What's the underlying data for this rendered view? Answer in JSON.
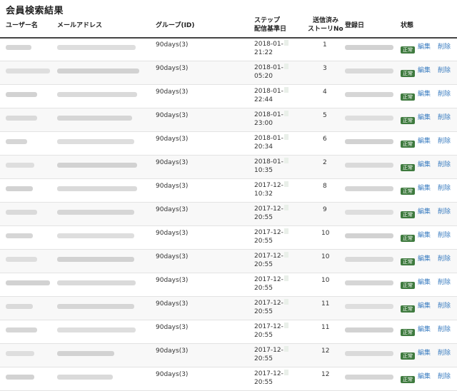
{
  "title": "会員検索結果",
  "columns": {
    "user": "ユーザー名",
    "email": "メールアドレス",
    "group": "グループ(ID)",
    "step_l1": "ステップ",
    "step_l2": "配信基準日",
    "sent_l1": "送信済み",
    "sent_l2": "ストーリNo",
    "registered": "登録日",
    "status": "状態"
  },
  "colors": {
    "badge": "#3e7a3e",
    "link": "#3a7cc0",
    "rule": "#444444"
  },
  "rows": [
    {
      "group": "90days(3)",
      "step_date": "2018-01-",
      "step_time": "21:22",
      "story_no": "1",
      "status": "正常",
      "edit": "編集",
      "delete": "削除"
    },
    {
      "group": "90days(3)",
      "step_date": "2018-01-",
      "step_time": "05:20",
      "story_no": "3",
      "status": "正常",
      "edit": "編集",
      "delete": "削除"
    },
    {
      "group": "90days(3)",
      "step_date": "2018-01-",
      "step_time": "22:44",
      "story_no": "4",
      "status": "正常",
      "edit": "編集",
      "delete": "削除"
    },
    {
      "group": "90days(3)",
      "step_date": "2018-01-",
      "step_time": "23:00",
      "story_no": "5",
      "status": "正常",
      "edit": "編集",
      "delete": "削除"
    },
    {
      "group": "90days(3)",
      "step_date": "2018-01-",
      "step_time": "20:34",
      "story_no": "6",
      "status": "正常",
      "edit": "編集",
      "delete": "削除"
    },
    {
      "group": "90days(3)",
      "step_date": "2018-01-",
      "step_time": "10:35",
      "story_no": "2",
      "status": "正常",
      "edit": "編集",
      "delete": "削除"
    },
    {
      "group": "90days(3)",
      "step_date": "2017-12-",
      "step_time": "10:32",
      "story_no": "8",
      "status": "正常",
      "edit": "編集",
      "delete": "削除"
    },
    {
      "group": "90days(3)",
      "step_date": "2017-12-",
      "step_time": "20:55",
      "story_no": "9",
      "status": "正常",
      "edit": "編集",
      "delete": "削除"
    },
    {
      "group": "90days(3)",
      "step_date": "2017-12-",
      "step_time": "20:55",
      "story_no": "10",
      "status": "正常",
      "edit": "編集",
      "delete": "削除"
    },
    {
      "group": "90days(3)",
      "step_date": "2017-12-",
      "step_time": "20:55",
      "story_no": "10",
      "status": "正常",
      "edit": "編集",
      "delete": "削除"
    },
    {
      "group": "90days(3)",
      "step_date": "2017-12-",
      "step_time": "20:55",
      "story_no": "10",
      "status": "正常",
      "edit": "編集",
      "delete": "削除"
    },
    {
      "group": "90days(3)",
      "step_date": "2017-12-",
      "step_time": "20:55",
      "story_no": "11",
      "status": "正常",
      "edit": "編集",
      "delete": "削除"
    },
    {
      "group": "90days(3)",
      "step_date": "2017-12-",
      "step_time": "20:55",
      "story_no": "11",
      "status": "正常",
      "edit": "編集",
      "delete": "削除"
    },
    {
      "group": "90days(3)",
      "step_date": "2017-12-",
      "step_time": "20:55",
      "story_no": "12",
      "status": "正常",
      "edit": "編集",
      "delete": "削除"
    },
    {
      "group": "90days(3)",
      "step_date": "2017-12-",
      "step_time": "20:55",
      "story_no": "12",
      "status": "正常",
      "edit": "編集",
      "delete": "削除"
    }
  ]
}
